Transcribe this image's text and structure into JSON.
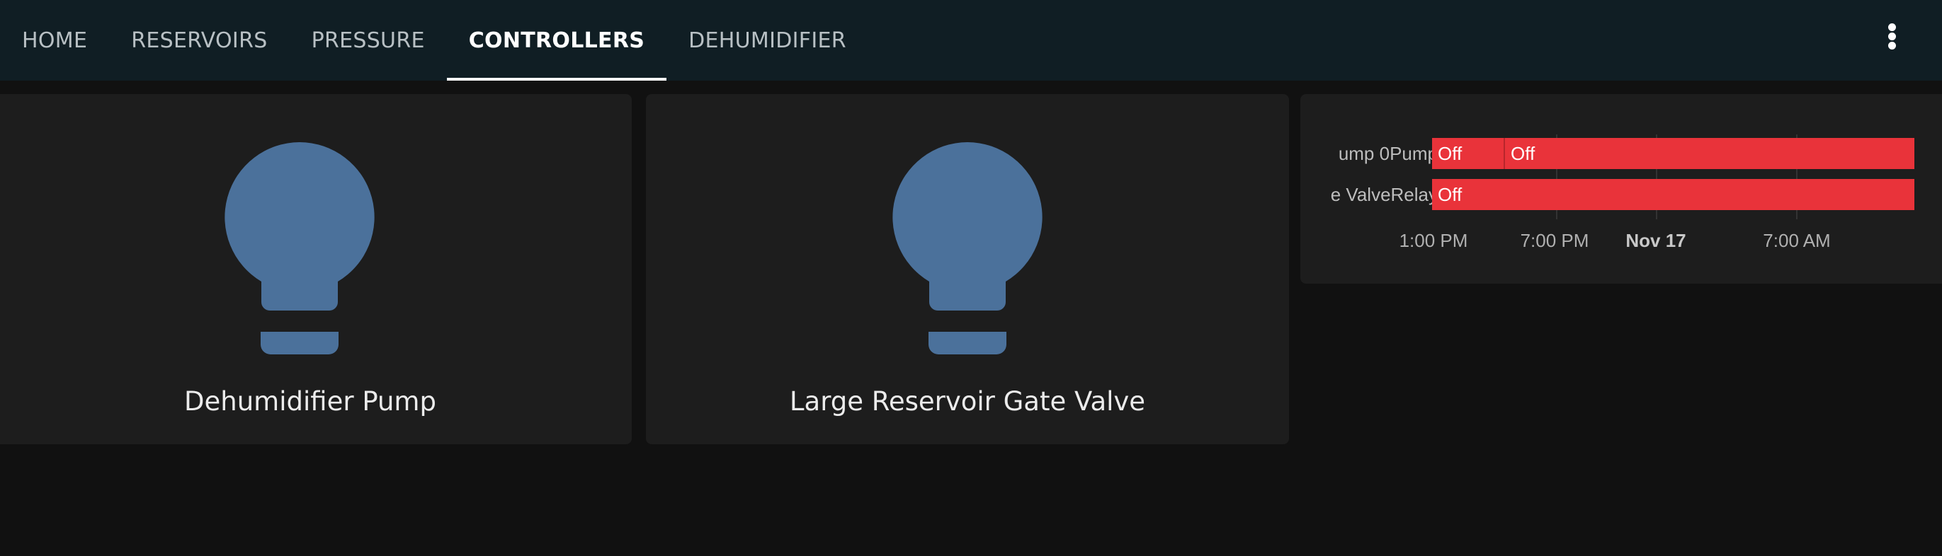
{
  "tabs": [
    {
      "label": "HOME",
      "active": false
    },
    {
      "label": "RESERVOIRS",
      "active": false
    },
    {
      "label": "PRESSURE",
      "active": false
    },
    {
      "label": "CONTROLLERS",
      "active": true
    },
    {
      "label": "DEHUMIDIFIER",
      "active": false
    }
  ],
  "header": {
    "menu_icon": "dots-vertical-icon"
  },
  "entities": [
    {
      "name": "Dehumidifier Pump",
      "icon": "lightbulb-icon",
      "icon_color": "#4b719b"
    },
    {
      "name": "Large Reservoir Gate Valve",
      "icon": "lightbulb-icon",
      "icon_color": "#4b719b"
    }
  ],
  "history": {
    "rows": [
      {
        "label": "ump 0Pump",
        "segments": [
          {
            "state": "Off"
          },
          {
            "state": "Off"
          }
        ]
      },
      {
        "label": "e ValveRelay",
        "segments": [
          {
            "state": "Off"
          }
        ]
      }
    ],
    "ticks": [
      "1:00 PM",
      "7:00 PM",
      "Nov 17",
      "7:00 AM"
    ],
    "state_color": "#e9333a"
  }
}
